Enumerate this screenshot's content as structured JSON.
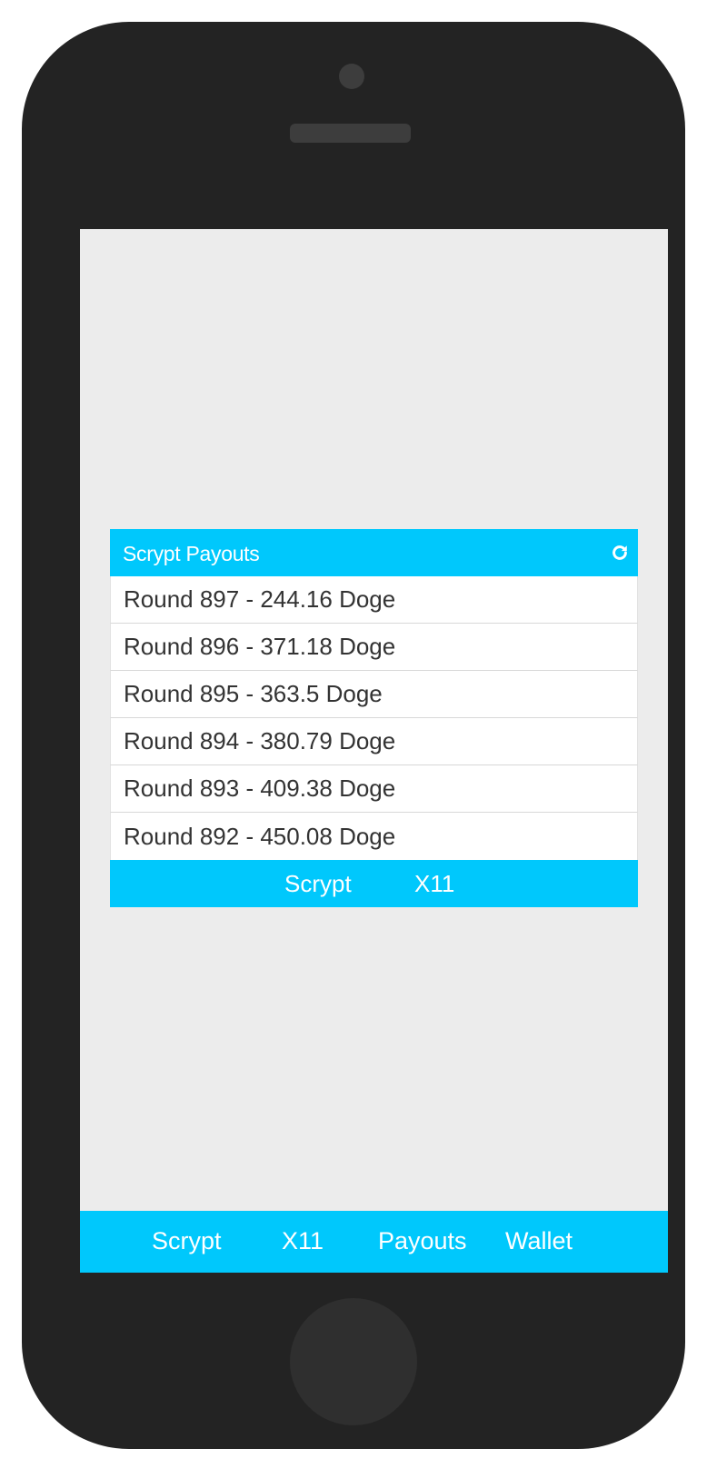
{
  "panel": {
    "title": "Scrypt Payouts",
    "refresh_icon": "refresh-icon",
    "rows": [
      "Round 897 - 244.16 Doge",
      "Round 896 - 371.18 Doge",
      "Round 895 - 363.5 Doge",
      "Round 894 - 380.79 Doge",
      "Round 893 - 409.38 Doge",
      "Round 892 - 450.08 Doge"
    ],
    "tabs": [
      "Scrypt",
      "X11"
    ]
  },
  "bottom_nav": {
    "items": [
      "Scrypt",
      "X11",
      "Payouts",
      "Wallet"
    ]
  },
  "colors": {
    "accent": "#00c8fc",
    "screen_background": "#ececec",
    "device_body": "#232323"
  }
}
